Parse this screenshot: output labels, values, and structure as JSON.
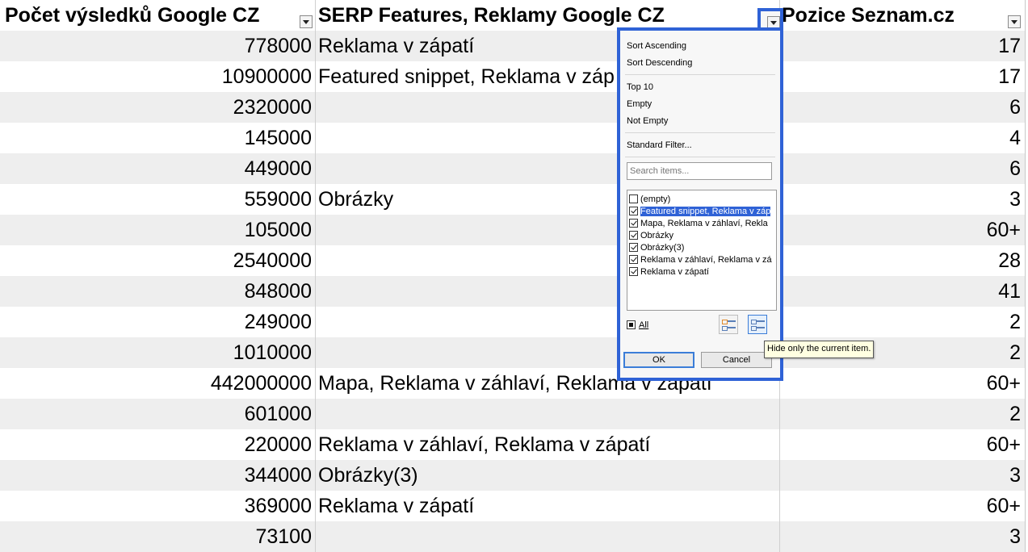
{
  "headers": {
    "col1": "Počet výsledků Google CZ",
    "col2": "SERP Features, Reklamy Google CZ",
    "col3": "Pozice Seznam.cz"
  },
  "rows": [
    {
      "c1": "778000",
      "c2": "Reklama v zápatí",
      "c3": "17"
    },
    {
      "c1": "10900000",
      "c2": "Featured snippet, Reklama v záp",
      "c3": "17"
    },
    {
      "c1": "2320000",
      "c2": "",
      "c3": "6"
    },
    {
      "c1": "145000",
      "c2": "",
      "c3": "4"
    },
    {
      "c1": "449000",
      "c2": "",
      "c3": "6"
    },
    {
      "c1": "559000",
      "c2": "Obrázky",
      "c3": "3"
    },
    {
      "c1": "105000",
      "c2": "",
      "c3": "60+"
    },
    {
      "c1": "2540000",
      "c2": "",
      "c3": "28"
    },
    {
      "c1": "848000",
      "c2": "",
      "c3": "41"
    },
    {
      "c1": "249000",
      "c2": "",
      "c3": "2"
    },
    {
      "c1": "1010000",
      "c2": "",
      "c3": "2"
    },
    {
      "c1": "442000000",
      "c2": "Mapa, Reklama v záhlaví, Reklama v zápatí",
      "c3": "60+"
    },
    {
      "c1": "601000",
      "c2": "",
      "c3": "2"
    },
    {
      "c1": "220000",
      "c2": "Reklama v záhlaví, Reklama v zápatí",
      "c3": "60+"
    },
    {
      "c1": "344000",
      "c2": "Obrázky(3)",
      "c3": "3"
    },
    {
      "c1": "369000",
      "c2": "Reklama v zápatí",
      "c3": "60+"
    },
    {
      "c1": "73100",
      "c2": "",
      "c3": "3"
    }
  ],
  "filter_popup": {
    "sort_ascending": "Sort Ascending",
    "sort_descending": "Sort Descending",
    "top10": "Top 10",
    "empty": "Empty",
    "not_empty": "Not Empty",
    "standard_filter": "Standard Filter...",
    "search_placeholder": "Search items...",
    "items": [
      {
        "label": "(empty)",
        "checked": false
      },
      {
        "label": "Featured snippet, Reklama v záp",
        "checked": true,
        "selected": true
      },
      {
        "label": "Mapa, Reklama v záhlaví, Rekla",
        "checked": true
      },
      {
        "label": "Obrázky",
        "checked": true
      },
      {
        "label": "Obrázky(3)",
        "checked": true
      },
      {
        "label": "Reklama v záhlaví, Reklama v zá",
        "checked": true
      },
      {
        "label": "Reklama v zápatí",
        "checked": true
      }
    ],
    "all_label": "All",
    "ok_label": "OK",
    "cancel_label": "Cancel",
    "tooltip": "Hide only the current item."
  },
  "colors": {
    "accent": "#2f62d6",
    "alt_row": "#eeeeee"
  }
}
